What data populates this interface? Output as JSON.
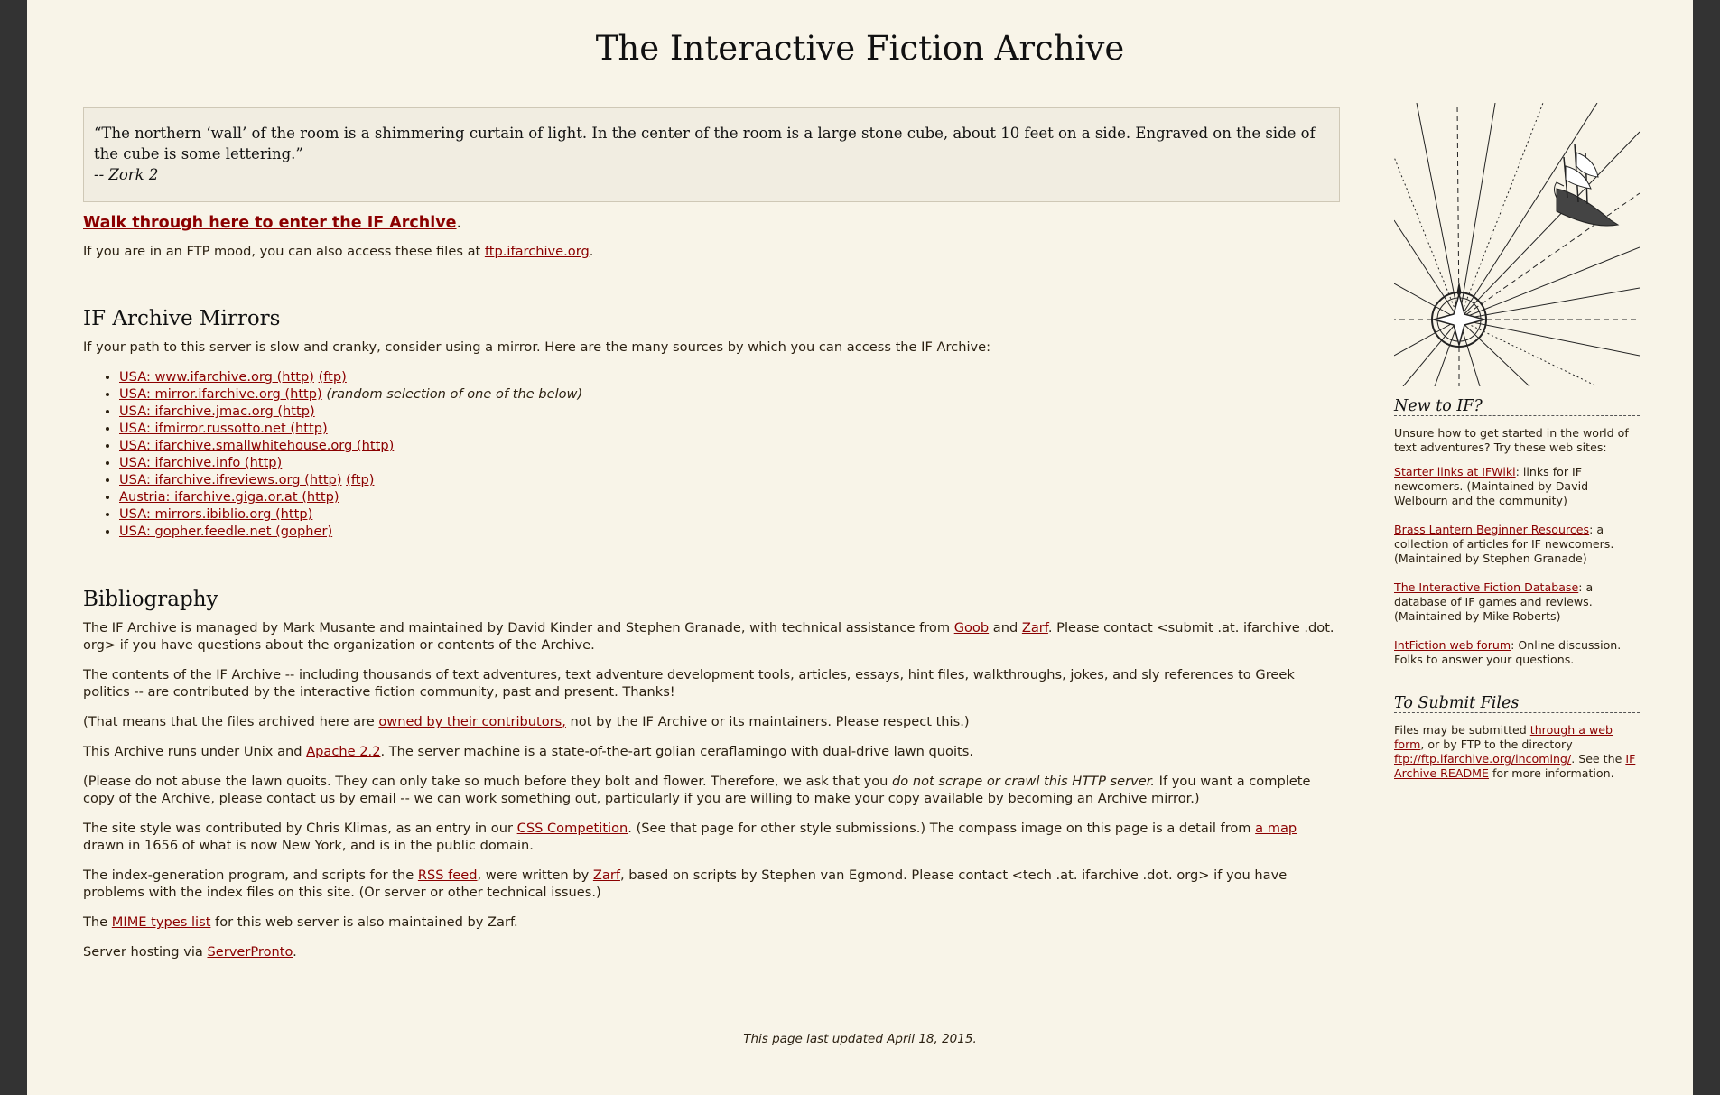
{
  "title": "The Interactive Fiction Archive",
  "quote": {
    "text": "“The northern ‘wall’ of the room is a shimmering curtain of light. In the center of the room is a large stone cube, about 10 feet on a side. Engraved on the side of the cube is some lettering.”",
    "attribution": "-- Zork 2"
  },
  "enter_link": "Walk through here to enter the IF Archive",
  "ftp_prefix": "If you are in an FTP mood, you can also access these files at ",
  "ftp_link": "ftp.ifarchive.org",
  "mirrors": {
    "heading": "IF Archive Mirrors",
    "intro": "If your path to this server is slow and cranky, consider using a mirror. Here are the many sources by which you can access the IF Archive:",
    "items": [
      {
        "label": "USA: www.ifarchive.org (http)",
        "extra": "(ftp)",
        "note": ""
      },
      {
        "label": "USA: mirror.ifarchive.org (http)",
        "extra": "",
        "note": "(random selection of one of the below)"
      },
      {
        "label": "USA: ifarchive.jmac.org (http)",
        "extra": "",
        "note": ""
      },
      {
        "label": "USA: ifmirror.russotto.net (http)",
        "extra": "",
        "note": ""
      },
      {
        "label": "USA: ifarchive.smallwhitehouse.org (http)",
        "extra": "",
        "note": ""
      },
      {
        "label": "USA: ifarchive.info (http)",
        "extra": "",
        "note": ""
      },
      {
        "label": "USA: ifarchive.ifreviews.org (http)",
        "extra": "(ftp)",
        "note": ""
      },
      {
        "label": "Austria: ifarchive.giga.or.at (http)",
        "extra": "",
        "note": ""
      },
      {
        "label": "USA: mirrors.ibiblio.org (http)",
        "extra": "",
        "note": ""
      },
      {
        "label": "USA: gopher.feedle.net (gopher)",
        "extra": "",
        "note": ""
      }
    ]
  },
  "bibliography": {
    "heading": "Bibliography",
    "p1": {
      "a": "The IF Archive is managed by Mark Musante and maintained by David Kinder and Stephen Granade, with technical assistance from ",
      "link1": "Goob",
      "b": " and ",
      "link2": "Zarf",
      "c": ". Please contact <submit .at. ifarchive .dot. org> if you have questions about the organization or contents of the Archive."
    },
    "p2": "The contents of the IF Archive -- including thousands of text adventures, text adventure development tools, articles, essays, hint files, walkthroughs, jokes, and sly references to Greek politics -- are contributed by the interactive fiction community, past and present. Thanks!",
    "p3": {
      "a": "(That means that the files archived here are ",
      "link": "owned by their contributors,",
      "b": " not by the IF Archive or its maintainers. Please respect this.)"
    },
    "p4": {
      "a": "This Archive runs under Unix and ",
      "link": "Apache 2.2",
      "b": ". The server machine is a state-of-the-art golian ceraflamingo with dual-drive lawn quoits."
    },
    "p5": {
      "a": "(Please do not abuse the lawn quoits. They can only take so much before they bolt and flower. Therefore, we ask that you ",
      "em": "do not scrape or crawl this HTTP server.",
      "b": " If you want a complete copy of the Archive, please contact us by email -- we can work something out, particularly if you are willing to make your copy available by becoming an Archive mirror.)"
    },
    "p6": {
      "a": "The site style was contributed by Chris Klimas, as an entry in our ",
      "link1": "CSS Competition",
      "b": ". (See that page for other style submissions.) The compass image on this page is a detail from ",
      "link2": "a map",
      "c": " drawn in 1656 of what is now New York, and is in the public domain."
    },
    "p7": {
      "a": "The index-generation program, and scripts for the ",
      "link1": "RSS feed",
      "b": ", were written by ",
      "link2": "Zarf",
      "c": ", based on scripts by Stephen van Egmond. Please contact <tech .at. ifarchive .dot. org> if you have problems with the index files on this site. (Or server or other technical issues.)"
    },
    "p8": {
      "a": "The ",
      "link": "MIME types list",
      "b": " for this web server is also maintained by Zarf."
    },
    "p9": {
      "a": "Server hosting via ",
      "link": "ServerPronto",
      "b": "."
    }
  },
  "footer": "This page last updated April 18, 2015.",
  "sidebar": {
    "new_heading": "New to IF?",
    "new_intro": "Unsure how to get started in the world of text adventures? Try these web sites:",
    "links": [
      {
        "link": "Starter links at IFWiki",
        "text": ": links for IF newcomers. (Maintained by David Welbourn and the community)"
      },
      {
        "link": "Brass Lantern Beginner Resources",
        "text": ": a collection of articles for IF newcomers. (Maintained by Stephen Granade)"
      },
      {
        "link": "The Interactive Fiction Database",
        "text": ": a database of IF games and reviews. (Maintained by Mike Roberts)"
      },
      {
        "link": "IntFiction web forum",
        "text": ": Online discussion. Folks to answer your questions."
      }
    ],
    "submit_heading": "To Submit Files",
    "submit": {
      "a": "Files may be submitted ",
      "link1": "through a web form",
      "b": ", or by FTP to the directory ",
      "link2": "ftp://ftp.ifarchive.org/incoming/",
      "c": ". See the ",
      "link3": "IF Archive README",
      "d": " for more information."
    }
  }
}
